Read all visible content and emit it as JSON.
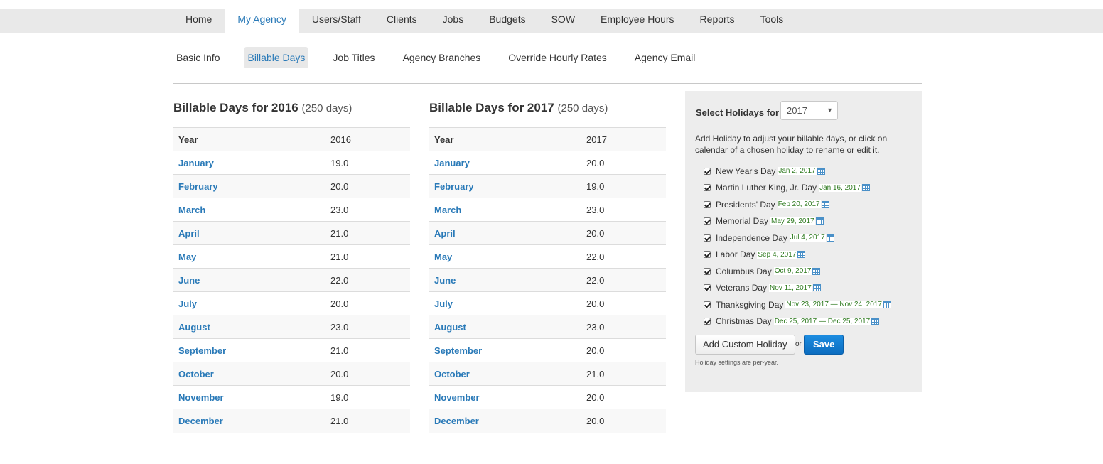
{
  "topnav": {
    "items": [
      {
        "label": "Home"
      },
      {
        "label": "My Agency"
      },
      {
        "label": "Users/Staff"
      },
      {
        "label": "Clients"
      },
      {
        "label": "Jobs"
      },
      {
        "label": "Budgets"
      },
      {
        "label": "SOW"
      },
      {
        "label": "Employee Hours"
      },
      {
        "label": "Reports"
      },
      {
        "label": "Tools"
      }
    ],
    "active": "My Agency"
  },
  "subnav": {
    "items": [
      {
        "label": "Basic Info"
      },
      {
        "label": "Billable Days"
      },
      {
        "label": "Job Titles"
      },
      {
        "label": "Agency Branches"
      },
      {
        "label": "Override Hourly Rates"
      },
      {
        "label": "Agency Email"
      }
    ],
    "active": "Billable Days"
  },
  "table2016": {
    "title": "Billable Days for 2016",
    "days": "(250 days)",
    "header": {
      "label": "Year",
      "value": "2016"
    },
    "rows": [
      {
        "month": "January",
        "value": "19.0"
      },
      {
        "month": "February",
        "value": "20.0"
      },
      {
        "month": "March",
        "value": "23.0"
      },
      {
        "month": "April",
        "value": "21.0"
      },
      {
        "month": "May",
        "value": "21.0"
      },
      {
        "month": "June",
        "value": "22.0"
      },
      {
        "month": "July",
        "value": "20.0"
      },
      {
        "month": "August",
        "value": "23.0"
      },
      {
        "month": "September",
        "value": "21.0"
      },
      {
        "month": "October",
        "value": "20.0"
      },
      {
        "month": "November",
        "value": "19.0"
      },
      {
        "month": "December",
        "value": "21.0"
      }
    ]
  },
  "table2017": {
    "title": "Billable Days for 2017",
    "days": "(250 days)",
    "header": {
      "label": "Year",
      "value": "2017"
    },
    "rows": [
      {
        "month": "January",
        "value": "20.0"
      },
      {
        "month": "February",
        "value": "19.0"
      },
      {
        "month": "March",
        "value": "23.0"
      },
      {
        "month": "April",
        "value": "20.0"
      },
      {
        "month": "May",
        "value": "22.0"
      },
      {
        "month": "June",
        "value": "22.0"
      },
      {
        "month": "July",
        "value": "20.0"
      },
      {
        "month": "August",
        "value": "23.0"
      },
      {
        "month": "September",
        "value": "20.0"
      },
      {
        "month": "October",
        "value": "21.0"
      },
      {
        "month": "November",
        "value": "20.0"
      },
      {
        "month": "December",
        "value": "20.0"
      }
    ]
  },
  "holidays": {
    "title": "Select Holidays for",
    "selected_year": "2017",
    "help": "Add Holiday to adjust your billable days, or click on calendar of a chosen holiday to rename or edit it.",
    "items": [
      {
        "name": "New Year's Day",
        "date": "Jan 2, 2017",
        "checked": true
      },
      {
        "name": "Martin Luther King, Jr. Day",
        "date": "Jan 16, 2017",
        "checked": true
      },
      {
        "name": "Presidents' Day",
        "date": "Feb 20, 2017",
        "checked": true
      },
      {
        "name": "Memorial Day",
        "date": "May 29, 2017",
        "checked": true
      },
      {
        "name": "Independence Day",
        "date": "Jul 4, 2017",
        "checked": true
      },
      {
        "name": "Labor Day",
        "date": "Sep 4, 2017",
        "checked": true
      },
      {
        "name": "Columbus Day",
        "date": "Oct 9, 2017",
        "checked": true
      },
      {
        "name": "Veterans Day",
        "date": "Nov 11, 2017",
        "checked": true
      },
      {
        "name": "Thanksgiving Day",
        "date": "Nov 23, 2017 — Nov 24, 2017",
        "checked": true
      },
      {
        "name": "Christmas Day",
        "date": "Dec 25, 2017 — Dec 25, 2017",
        "checked": true
      }
    ],
    "add_button": "Add Custom Holiday",
    "or_text": "or",
    "save_button": "Save",
    "note": "Holiday settings are per-year."
  },
  "colors": {
    "link": "#2a7ab8",
    "save_button": "#0c6dc0",
    "holiday_date": "#2d7a1e"
  },
  "icons": {
    "holiday_calendar": "calendar-icon",
    "select_arrow": "caret-down-icon"
  }
}
